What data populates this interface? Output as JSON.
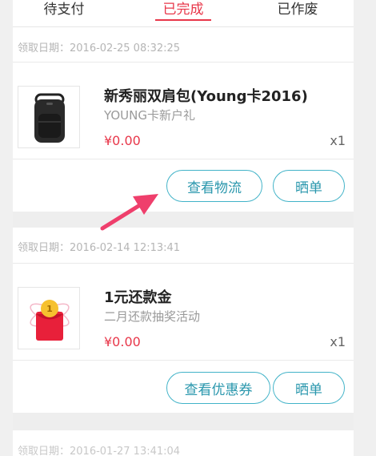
{
  "tabs": [
    {
      "label": "待支付",
      "active": false
    },
    {
      "label": "已完成",
      "active": true
    },
    {
      "label": "已作废",
      "active": false
    }
  ],
  "orders": [
    {
      "date": "领取日期：2016-02-25 08:32:25",
      "title": "新秀丽双肩包(Young卡2016)",
      "subtitle": "YOUNG卡新户礼",
      "price": "¥0.00",
      "qty": "x1",
      "thumbnail_icon": "backpack-icon",
      "buttons": [
        "查看物流",
        "晒单"
      ]
    },
    {
      "date": "领取日期：2016-02-14 12:13:41",
      "title": "1元还款金",
      "subtitle": "二月还款抽奖活动",
      "price": "¥0.00",
      "qty": "x1",
      "thumbnail_icon": "red-envelope-icon",
      "buttons": [
        "查看优惠券",
        "晒单"
      ]
    }
  ],
  "partial_date": "领取日期：2016-01-27 13:41:04",
  "colors": {
    "accent_red": "#e8374a",
    "button_teal": "#42b3c8",
    "annotation_arrow": "#ef3f6c"
  }
}
